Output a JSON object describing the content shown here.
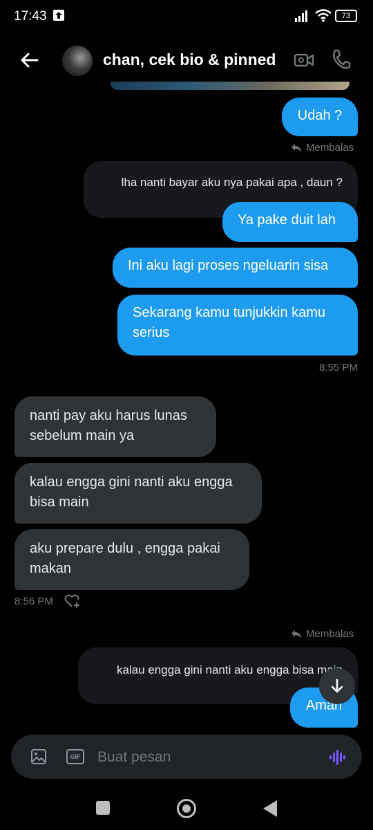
{
  "status_bar": {
    "time": "17:43",
    "battery": "73"
  },
  "header": {
    "title": "chan, cek bio & pinned"
  },
  "messages": {
    "m1": "Udah ?",
    "reply1_label": "Membalas",
    "reply1_quote": "lha nanti bayar aku nya pakai apa , daun ?",
    "m2": "Ya pake duit lah",
    "m3": "Ini aku lagi proses ngeluarin sisa",
    "m4_line1": "Sekarang kamu tunjukkin kamu",
    "m4_line2": "serius",
    "time1": "8:55 PM",
    "m5_line1": "nanti pay aku harus lunas",
    "m5_line2": "sebelum main ya",
    "m6_line1": "kalau engga gini nanti aku engga",
    "m6_line2": "bisa main",
    "m7_line1": "aku prepare dulu , engga pakai",
    "m7_line2": "makan",
    "time2": "8:56 PM",
    "reply2_label": "Membalas",
    "reply2_quote": "kalau engga gini nanti aku engga bisa main",
    "m8": "Aman"
  },
  "composer": {
    "placeholder": "Buat pesan",
    "gif_label": "GIF"
  },
  "colors": {
    "accent": "#1d9bf0",
    "incoming": "#2f3336",
    "voice": "#7856ff"
  }
}
